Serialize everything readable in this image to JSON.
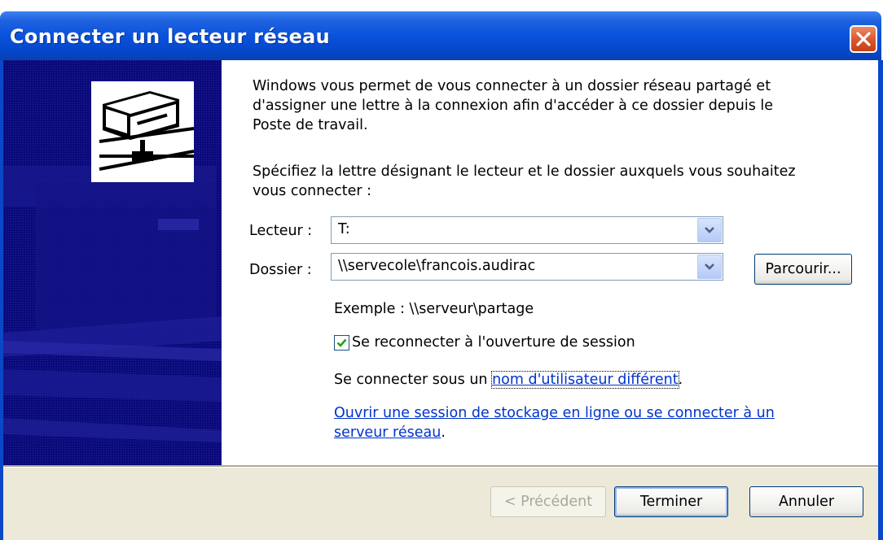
{
  "window": {
    "title": "Connecter un lecteur réseau"
  },
  "content": {
    "intro_line1": "Windows vous permet de vous connecter à un dossier réseau partagé et",
    "intro_line2": "d'assigner une lettre à la connexion afin d'accéder à ce dossier depuis le",
    "intro_line3": "Poste de travail.",
    "instruction_line1": "Spécifiez la lettre désignant le lecteur et le dossier auxquels vous souhaitez",
    "instruction_line2": "vous connecter :"
  },
  "drive": {
    "label": "Lecteur :",
    "value": "T:"
  },
  "folder": {
    "label": "Dossier :",
    "value": "\\\\servecole\\francois.audirac",
    "browse_label": "Parcourir...",
    "example": "Exemple : \\\\serveur\\partage"
  },
  "reconnect": {
    "label": "Se reconnecter à l'ouverture de session",
    "checked": true
  },
  "connect_as": {
    "prefix": "Se connecter sous un ",
    "link": "nom d'utilisateur différent",
    "suffix": "."
  },
  "storage_link": {
    "line1": "Ouvrir une session de stockage en ligne ou se connecter à un",
    "line2": "serveur réseau",
    "suffix": "."
  },
  "buttons": {
    "back": "< Précédent",
    "finish": "Terminer",
    "cancel": "Annuler"
  },
  "colors": {
    "title_bar": "#0a52dd",
    "side_panel": "#0a0a7a",
    "footer": "#ece9d8",
    "link": "#0033cc"
  }
}
